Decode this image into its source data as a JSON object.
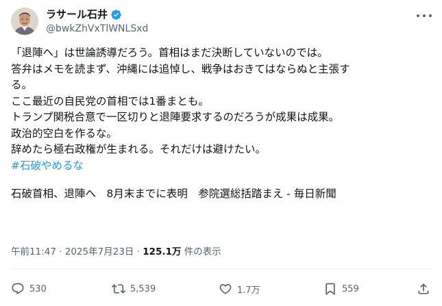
{
  "author": {
    "display_name": "ラサール石井",
    "handle": "@bwkZhVxTlWNLSxd",
    "verified": true
  },
  "tweet": {
    "lines": [
      "「退陣へ」は世論誘導だろう。首相はまだ決断していないのでは。",
      "答弁はメモを読まず、沖縄には追悼し、戦争はおきてはならぬと主張す",
      "る。",
      "ここ最近の自民党の首相では1番まとも。",
      "トランプ関税合意で一区切りと退陣要求するのだろうが成果は成果。",
      "政治的空白を作るな。",
      "辞めたら極右政権が生まれる。それだけは避けたい。"
    ],
    "hashtag": "#石破やめるな",
    "news_title": "石破首相、退陣へ　8月末までに表明　参院選総括踏まえ - 毎日新聞"
  },
  "meta": {
    "timestamp": "午前11:47 · 2025年7月23日 · ",
    "views_count": "125.1万",
    "views_label": " 件の表示"
  },
  "actions": {
    "replies": "530",
    "reposts": "5,539",
    "likes": "1.7万",
    "bookmarks": "559"
  },
  "colors": {
    "accent": "#1d9bf0",
    "text": "#0f1419",
    "secondary": "#536471"
  },
  "icons": [
    "verified-badge-icon",
    "more-icon",
    "reply-icon",
    "repost-icon",
    "like-icon",
    "bookmark-icon",
    "share-icon"
  ]
}
